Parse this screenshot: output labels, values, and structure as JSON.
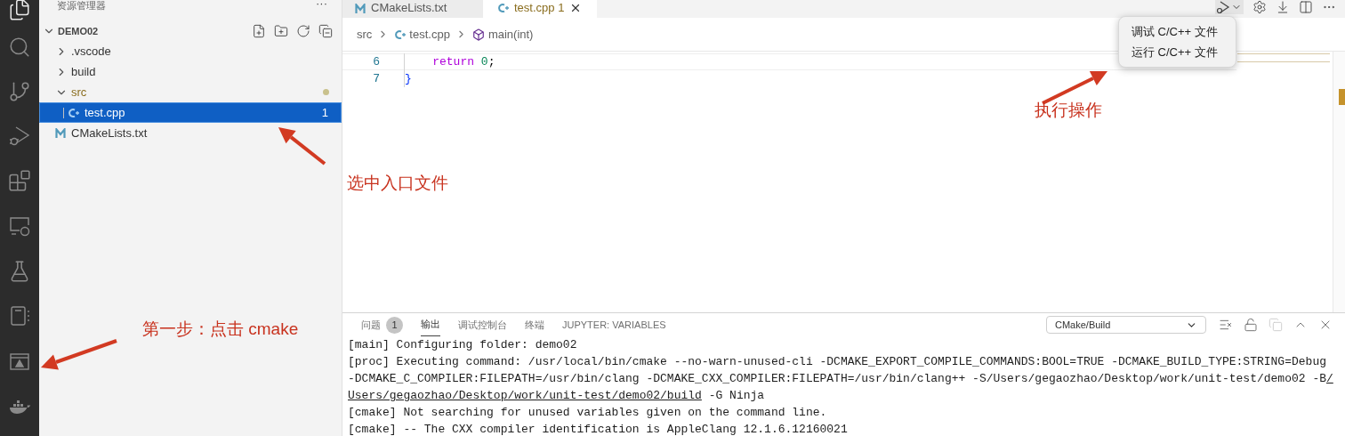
{
  "explorer": {
    "title": "资源管理器",
    "more": "···",
    "workspace": {
      "label": "DEMO02",
      "expanded": true
    },
    "tree": [
      {
        "label": ".vscode",
        "kind": "folder",
        "expanded": false,
        "selected": false,
        "problem": false
      },
      {
        "label": "build",
        "kind": "folder",
        "expanded": false,
        "selected": false,
        "problem": false
      },
      {
        "label": "src",
        "kind": "folder",
        "expanded": true,
        "selected": false,
        "problem": true,
        "children": [
          {
            "label": "test.cpp",
            "kind": "cpp",
            "selected": true,
            "badge": "1"
          }
        ]
      },
      {
        "label": "CMakeLists.txt",
        "kind": "cmake",
        "selected": false,
        "problem": false
      }
    ]
  },
  "editor": {
    "tabs": [
      {
        "label": "CMakeLists.txt",
        "kind": "cmake",
        "selected": false,
        "problem": false
      },
      {
        "label": "test.cpp",
        "kind": "cpp",
        "selected": true,
        "problem": true,
        "badge": "1"
      }
    ],
    "breadcrumb": [
      {
        "label": "src",
        "kind": "folder"
      },
      {
        "label": "test.cpp",
        "kind": "cpp"
      },
      {
        "label": "main(int)",
        "kind": "symbol"
      }
    ],
    "lines": [
      {
        "number": "6",
        "current": true,
        "tokens": [
          {
            "text": "    return",
            "kind": "keyword"
          },
          {
            "text": " 0",
            "kind": "number"
          },
          {
            "text": ";",
            "kind": "plain"
          }
        ]
      },
      {
        "number": "7",
        "current": false,
        "tokens": [
          {
            "text": "}",
            "kind": "bracket"
          }
        ]
      }
    ],
    "run_menu": {
      "items": [
        "调试 C/C++ 文件",
        "运行 C/C++ 文件"
      ]
    }
  },
  "panel": {
    "tabs": [
      {
        "label": "问题",
        "badge": "1",
        "selected": false
      },
      {
        "label": "输出",
        "selected": true
      },
      {
        "label": "调试控制台",
        "selected": false
      },
      {
        "label": "终端",
        "selected": false
      },
      {
        "label": "JUPYTER: VARIABLES",
        "selected": false
      }
    ],
    "channel": "CMake/Build",
    "output": [
      [
        {
          "text": "[main] Configuring folder: demo02",
          "link": false
        }
      ],
      [
        {
          "text": "[proc] Executing command: /usr/local/bin/cmake --no-warn-unused-cli -DCMAKE_EXPORT_COMPILE_COMMANDS:BOOL=TRUE -DCMAKE_BUILD_TYPE:STRING=Debug",
          "link": false
        }
      ],
      [
        {
          "text": "-DCMAKE_C_COMPILER:FILEPATH=/usr/bin/clang -DCMAKE_CXX_COMPILER:FILEPATH=/usr/bin/clang++ -S/Users/gegaozhao/Desktop/work/unit-test/demo02 -B",
          "link": false
        },
        {
          "text": "/",
          "link": true
        }
      ],
      [
        {
          "text": "Users/gegaozhao/Desktop/work/unit-test/demo02/build",
          "link": true
        },
        {
          "text": " -G Ninja",
          "link": false
        }
      ],
      [
        {
          "text": "[cmake] Not searching for unused variables given on the command line.",
          "link": false
        }
      ],
      [
        {
          "text": "[cmake] -- The CXX compiler identification is AppleClang 12.1.6.12160021",
          "link": false
        }
      ]
    ]
  },
  "annotations": [
    {
      "text": "选中入口文件"
    },
    {
      "text": "执行操作"
    },
    {
      "text": "第一步：点击 cmake"
    }
  ]
}
